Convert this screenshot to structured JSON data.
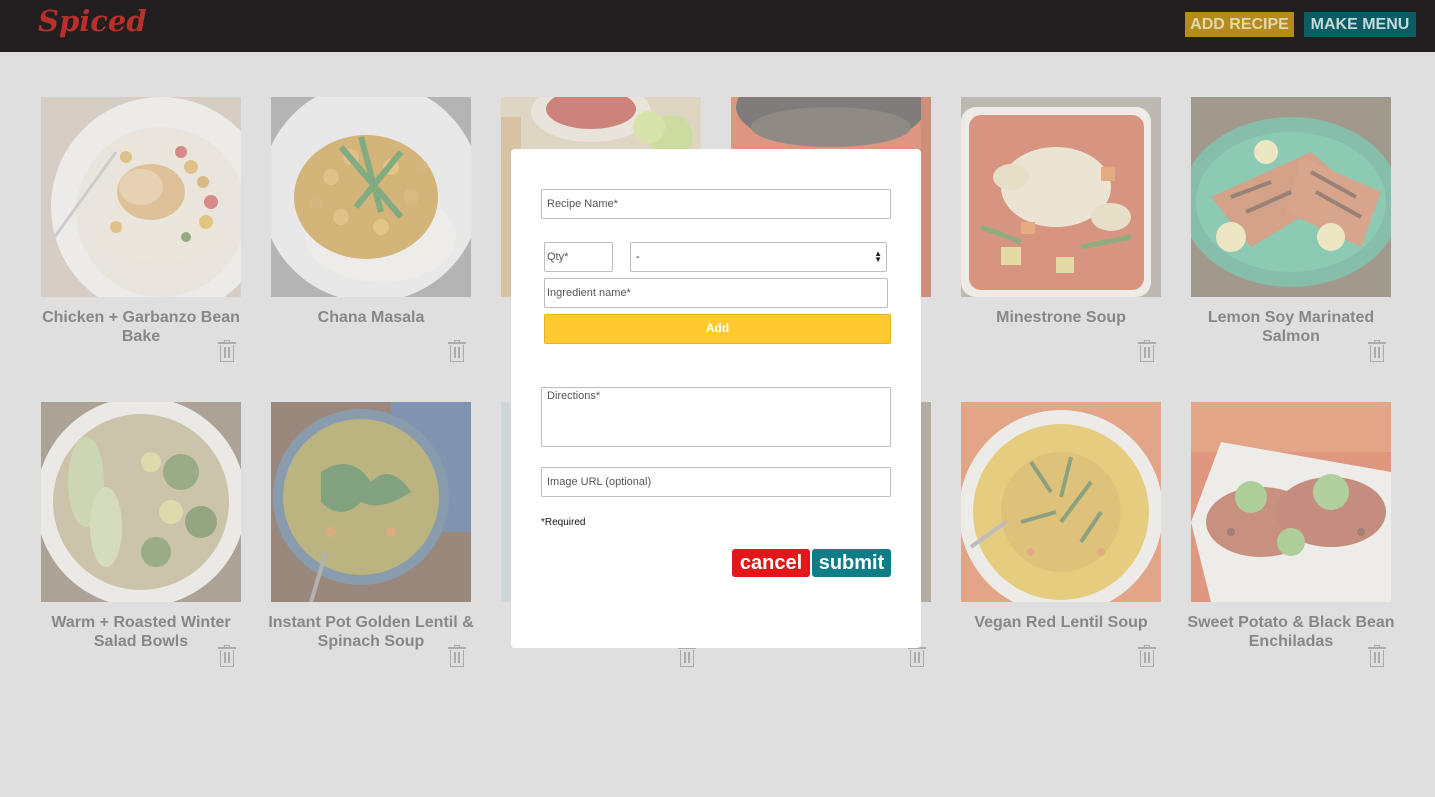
{
  "header": {
    "logo": "Spiced",
    "add_recipe_label": "ADD RECIPE",
    "make_menu_label": "MAKE MENU"
  },
  "recipes": [
    {
      "title": "Chicken + Garbanzo Bean Bake",
      "food_image": "chicken-garbanzo-bean-bake-photo"
    },
    {
      "title": "Chana Masala",
      "food_image": "chana-masala-photo"
    },
    {
      "title": "",
      "food_image": "salsa-and-lime-photo"
    },
    {
      "title": "",
      "food_image": "black-bean-soup-photo"
    },
    {
      "title": "Minestrone Soup",
      "food_image": "minestrone-soup-photo"
    },
    {
      "title": "Lemon Soy Marinated Salmon",
      "food_image": "lemon-soy-salmon-photo"
    },
    {
      "title": "Warm + Roasted Winter Salad Bowls",
      "food_image": "winter-salad-bowl-photo"
    },
    {
      "title": "Instant Pot Golden Lentil & Spinach Soup",
      "food_image": "lentil-spinach-soup-photo"
    },
    {
      "title": "",
      "food_image": "hidden-recipe-photo"
    },
    {
      "title": "",
      "food_image": "hidden-recipe-photo"
    },
    {
      "title": "Vegan Red Lentil Soup",
      "food_image": "red-lentil-soup-photo"
    },
    {
      "title": "Sweet Potato & Black Bean Enchiladas",
      "food_image": "enchiladas-photo"
    }
  ],
  "modal": {
    "recipe_name_placeholder": "Recipe Name*",
    "qty_placeholder": "Qty*",
    "unit_selected": "-",
    "ingredient_placeholder": "Ingredient name*",
    "add_label": "Add",
    "directions_placeholder": "Directions*",
    "image_url_placeholder": "Image URL (optional)",
    "required_note": "*Required",
    "cancel_label": "cancel",
    "submit_label": "submit"
  },
  "colors": {
    "header_bg": "#231f20",
    "logo": "#c8261f",
    "add_recipe_bg": "#c99b1b",
    "make_menu_bg": "#0e7d86",
    "add_button": "#ffc931",
    "cancel": "#e3171a",
    "submit": "#0e7d86"
  }
}
